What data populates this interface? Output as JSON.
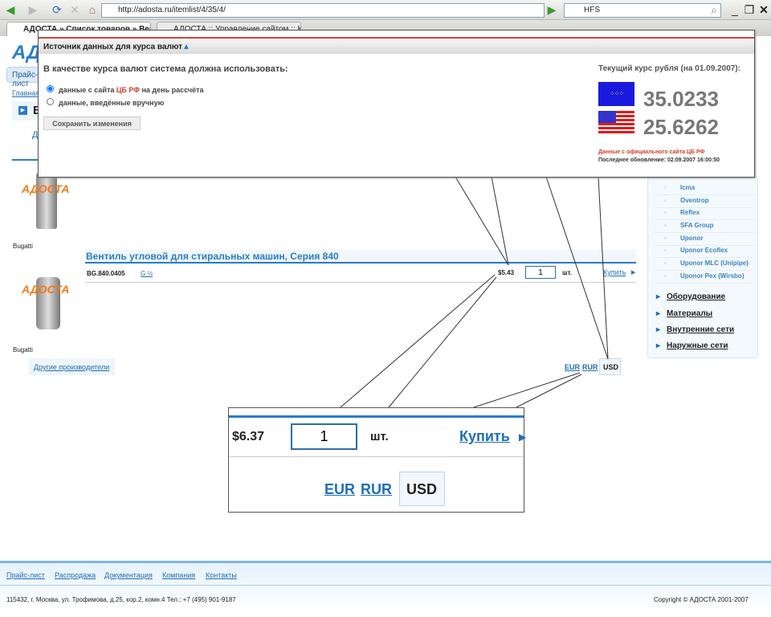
{
  "browser": {
    "url": "http://adosta.ru/itemlist/4/35/4/",
    "search_value": "HFS",
    "tabs": [
      {
        "label": "АДОСТА » Список товаров » Вен..."
      },
      {
        "label": "АДОСТА :: Управление сайтом :: Ку..."
      }
    ]
  },
  "site": {
    "logo": "АДОСТА",
    "nav_tab": "Прайс-лист",
    "breadcrumb": "Главная",
    "section_title": "В",
    "sublink": "Д"
  },
  "popup": {
    "title": "Источник данных для курса валют",
    "question": "В качестве курса валют система должна использовать:",
    "option1_prefix": "данные с сайта ",
    "option1_highlight": "ЦБ РФ",
    "option1_suffix": " на день рассчёта",
    "option2": "данные, введённые вручную",
    "selected_option": 1,
    "save_button": "Сохранить изменения",
    "rate_title": "Текущий курс рубля (на 01.09.2007):",
    "eur_rate": "35.0233",
    "usd_rate": "25.6262",
    "source_note": "Данные с официального сайта ЦБ РФ",
    "last_update": "Последнее обновление: 02.09.2007 16:00:50"
  },
  "products": {
    "brand1": "Bugatti",
    "image_watermark": "АДОСТА",
    "series_title": "Вентиль угловой для стиральных машин, Серия 840",
    "row": {
      "sku": "BG.840.0405",
      "size": "G ½",
      "price": "$5.43",
      "qty": "1",
      "unit": "шт.",
      "buy": "Купить"
    },
    "brand2": "Bugatti",
    "other_makers": "Другие производители",
    "currencies": [
      "EUR",
      "RUR",
      "USD"
    ],
    "active_currency": "USD"
  },
  "sidebar": {
    "brands": [
      "Icma",
      "Oventrop",
      "Reflex",
      "SFA Group",
      "Uponor",
      "Uponor Ecoflex",
      "Uponor MLC (Unipipe)",
      "Uponor Pex (Wirsbo)"
    ],
    "categories": [
      "Оборудование",
      "Материалы",
      "Внутренние сети",
      "Наружные сети"
    ]
  },
  "zoom_callout": {
    "price": "$6.37",
    "qty": "1",
    "unit": "шт.",
    "buy": "Купить",
    "currencies": [
      "EUR",
      "RUR",
      "USD"
    ]
  },
  "footer": {
    "links": [
      "Прайс-лист",
      "Распродажа",
      "Документация",
      "Компания",
      "Контакты"
    ],
    "address": "115432, г. Москва, ул. Трофимова, д.25, кор.2, комн.4 Тел.: +7 (495) 901-9187",
    "copyright": "Copyright © АДОСТА 2001-2007"
  },
  "colors": {
    "accent": "#1f6fb5",
    "highlight_red": "#d0402f",
    "orange_logo": "#f07a1a"
  }
}
